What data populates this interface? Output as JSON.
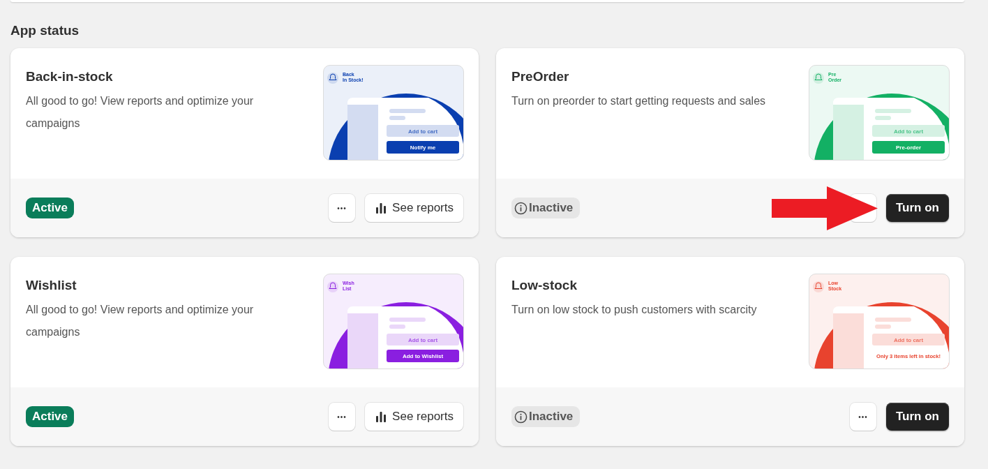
{
  "section_title": "App status",
  "cards": [
    {
      "title": "Back-in-stock",
      "description": "All good to go! View reports and optimize your campaigns",
      "status": {
        "label": "Active",
        "kind": "active"
      },
      "actions": [
        {
          "kind": "more",
          "label": "•••"
        },
        {
          "kind": "reports",
          "label": "See reports"
        }
      ],
      "highlighted": false,
      "preview": {
        "title_lines": [
          "Back",
          "In Stock!"
        ],
        "secondary": "Add to cart",
        "cta": "Notify me",
        "kind": "button",
        "color": "#0a3fb0"
      }
    },
    {
      "title": "PreOrder",
      "description": "Turn on preorder to start getting requests and sales",
      "status": {
        "label": "Inactive",
        "kind": "inactive"
      },
      "actions": [
        {
          "kind": "more"
        },
        {
          "kind": "turn_on",
          "label": "Turn on"
        }
      ],
      "highlighted": true,
      "preview": {
        "title_lines": [
          "Pre",
          "Order"
        ],
        "secondary": "Add to cart",
        "cta": "Pre-order",
        "kind": "button",
        "color": "#13b064"
      }
    },
    {
      "title": "Wishlist",
      "description": "All good to go! View reports and optimize your campaigns",
      "status": {
        "label": "Active",
        "kind": "active"
      },
      "actions": [
        {
          "kind": "more",
          "label": "•••"
        },
        {
          "kind": "reports",
          "label": "See reports"
        }
      ],
      "highlighted": false,
      "preview": {
        "title_lines": [
          "Wish",
          "List"
        ],
        "secondary": "Add to cart",
        "cta": "Add to Wishlist",
        "kind": "button",
        "color": "#8a1fe0"
      }
    },
    {
      "title": "Low-stock",
      "description": "Turn on low stock to push customers with scarcity",
      "status": {
        "label": "Inactive",
        "kind": "inactive"
      },
      "actions": [
        {
          "kind": "more",
          "label": "•••"
        },
        {
          "kind": "turn_on",
          "label": "Turn on"
        }
      ],
      "highlighted": false,
      "preview": {
        "title_lines": [
          "Low",
          "Stock"
        ],
        "secondary": "Add to cart",
        "cta": "Only 3 items left in stock!",
        "kind": "text",
        "color": "#e8432e"
      }
    }
  ]
}
